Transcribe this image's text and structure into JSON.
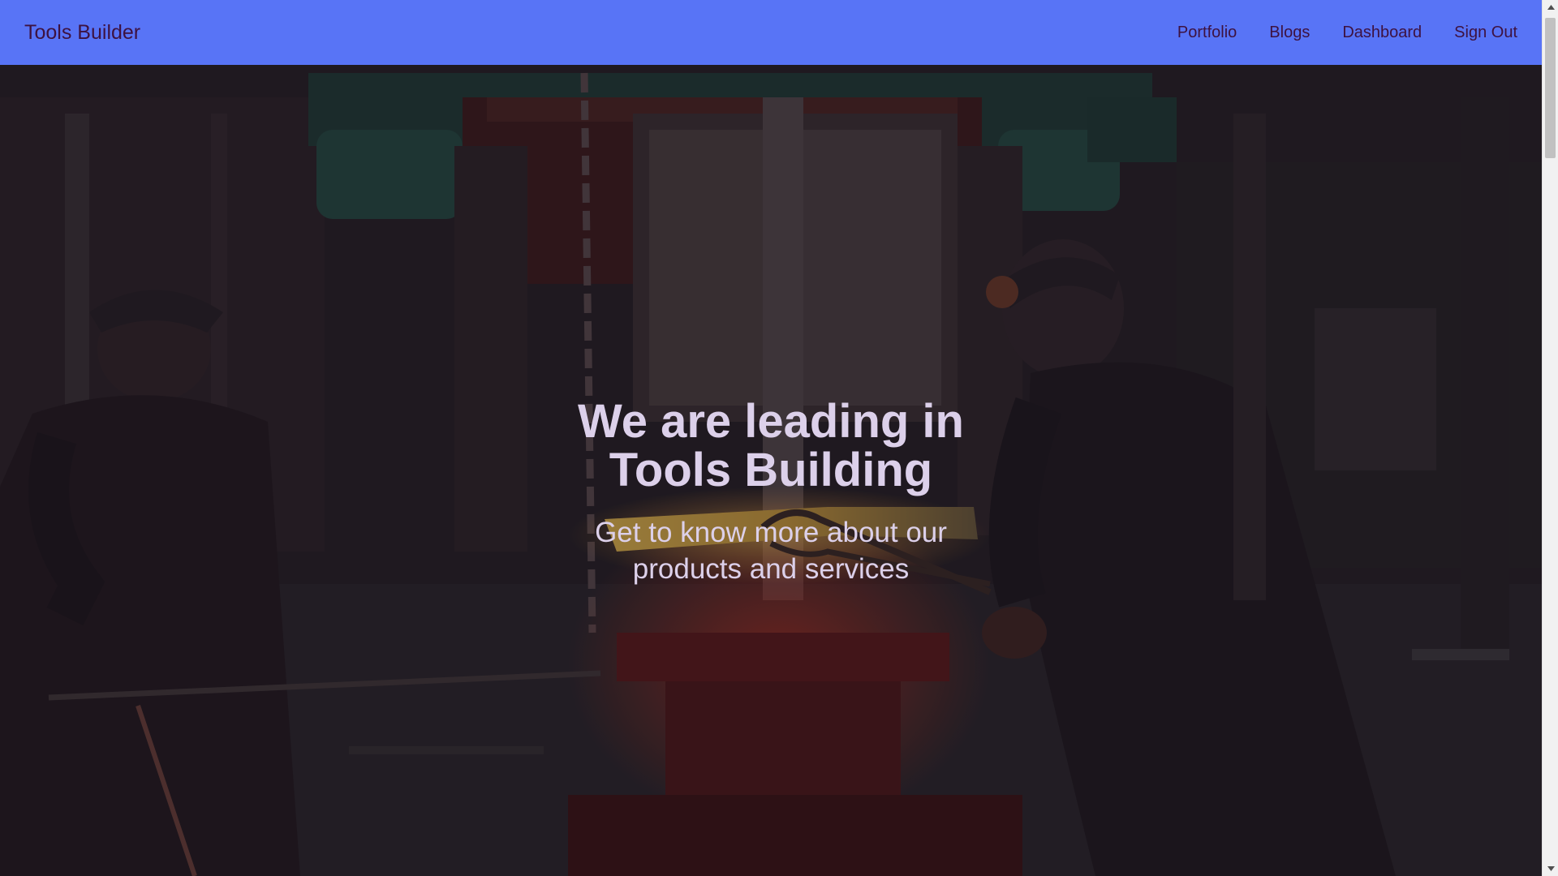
{
  "navbar": {
    "brand": "Tools Builder",
    "links": [
      {
        "label": "Portfolio"
      },
      {
        "label": "Blogs"
      },
      {
        "label": "Dashboard"
      },
      {
        "label": "Sign Out"
      }
    ]
  },
  "hero": {
    "title": "We are leading in Tools Building",
    "subtitle": "Get to know more about our products and services",
    "background_icon": "blacksmith-forge-photo"
  },
  "scrollbar": {
    "up_icon": "scroll-up-arrow-icon",
    "down_icon": "scroll-down-arrow-icon"
  },
  "colors": {
    "navbar": "#5874f6",
    "nav_text": "#3d1240",
    "hero_text": "#dcd0ea",
    "hero_bg": "#1b1618"
  }
}
